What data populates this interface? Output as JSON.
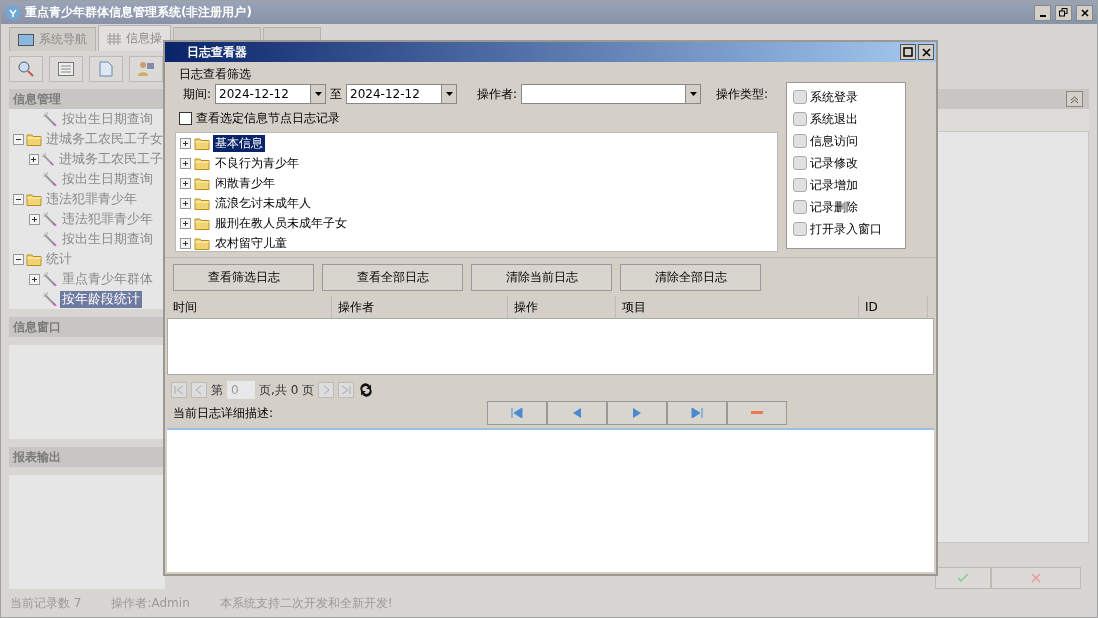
{
  "window": {
    "title": "重点青少年群体信息管理系统(非注册用户)"
  },
  "tabs": [
    {
      "label": "系统导航",
      "selected": false
    },
    {
      "label": "信息操",
      "selected": true
    }
  ],
  "info_management": {
    "title": "信息管理",
    "tree": [
      {
        "kind": "tail",
        "children": [
          {
            "kind": "leaf",
            "label": "按出生日期查询",
            "selected": false
          }
        ]
      },
      {
        "kind": "folder",
        "label": "进城务工农民工子女",
        "expanded": true,
        "selected": false,
        "children": [
          {
            "kind": "query",
            "label": "进城务工农民工子",
            "expanded": false,
            "selected": false
          },
          {
            "kind": "leaf",
            "label": "按出生日期查询",
            "selected": false
          }
        ]
      },
      {
        "kind": "folder",
        "label": "违法犯罪青少年",
        "expanded": true,
        "selected": false,
        "children": [
          {
            "kind": "query",
            "label": "违法犯罪青少年",
            "expanded": false,
            "selected": false
          },
          {
            "kind": "leaf",
            "label": "按出生日期查询",
            "selected": false
          }
        ]
      },
      {
        "kind": "folder",
        "label": "统计",
        "expanded": true,
        "selected": false,
        "children": [
          {
            "kind": "query",
            "label": "重点青少年群体",
            "expanded": false,
            "selected": false
          },
          {
            "kind": "leaf",
            "label": "按年龄段统计",
            "selected": true
          }
        ]
      }
    ]
  },
  "info_window": {
    "title": "信息窗口"
  },
  "report_output": {
    "title": "报表输出"
  },
  "status_bar": [
    "当前记录数 7",
    "操作者:Admin",
    "本系统支持二次开发和全新开发!"
  ],
  "log_viewer": {
    "title": "日志查看器",
    "filter_title": "日志查看筛选",
    "period_label": "期间:",
    "date_from": "2024-12-12",
    "to_label": "至",
    "date_to": "2024-12-12",
    "operator_label": "操作者:",
    "operation_type_label": "操作类型:",
    "operation_types": [
      {
        "label": "系统登录",
        "checked": false
      },
      {
        "label": "系统退出",
        "checked": false
      },
      {
        "label": "信息访问",
        "checked": false
      },
      {
        "label": "记录修改",
        "checked": false
      },
      {
        "label": "记录增加",
        "checked": false
      },
      {
        "label": "记录删除",
        "checked": false
      },
      {
        "label": "打开录入窗口",
        "checked": false
      }
    ],
    "node_filter": {
      "label": "查看选定信息节点日志记录",
      "checked": false
    },
    "tree": [
      {
        "label": "基本信息",
        "selected": true
      },
      {
        "label": "不良行为青少年",
        "selected": false
      },
      {
        "label": "闲散青少年",
        "selected": false
      },
      {
        "label": "流浪乞讨未成年人",
        "selected": false
      },
      {
        "label": "服刑在教人员未成年子女",
        "selected": false
      },
      {
        "label": "农村留守儿童",
        "selected": false
      }
    ],
    "buttons": [
      "查看筛选日志",
      "查看全部日志",
      "清除当前日志",
      "清除全部日志"
    ],
    "table": {
      "columns": [
        "时间",
        "操作者",
        "操作",
        "项目",
        "ID"
      ]
    },
    "pager": {
      "page_label": "第",
      "page": "0",
      "total": "页,共 0 页"
    },
    "detail_label": "当前日志详细描述:"
  }
}
